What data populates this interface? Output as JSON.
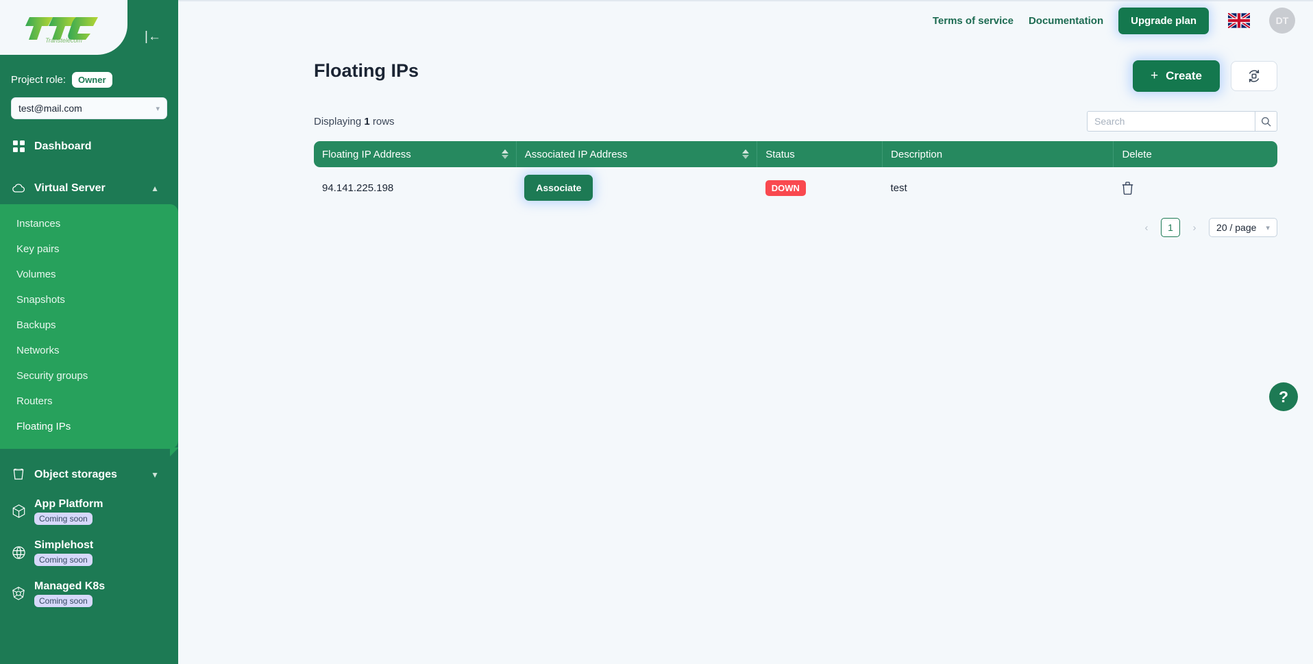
{
  "header": {
    "links": [
      {
        "label": "Terms of service",
        "name": "terms-of-service-link"
      },
      {
        "label": "Documentation",
        "name": "documentation-link"
      }
    ],
    "upgrade_label": "Upgrade plan",
    "language": "English",
    "avatar_initials": "DT"
  },
  "sidebar": {
    "logo_text": "TTC",
    "logo_subtext": "Transtelecom",
    "collapse_glyph": "|←",
    "role_label": "Project role:",
    "role_value": "Owner",
    "project": "test@mail.com",
    "dashboard": "Dashboard",
    "group": {
      "label": "Virtual Server",
      "items": [
        "Instances",
        "Key pairs",
        "Volumes",
        "Snapshots",
        "Backups",
        "Networks",
        "Security groups",
        "Routers",
        "Floating IPs"
      ],
      "active": "Floating IPs"
    },
    "object_storages": "Object storages",
    "soon_items": [
      {
        "label": "App Platform",
        "badge": "Coming soon"
      },
      {
        "label": "Simplehost",
        "badge": "Coming soon"
      },
      {
        "label": "Managed K8s",
        "badge": "Coming soon"
      }
    ]
  },
  "main": {
    "title": "Floating IPs",
    "create_label": "Create",
    "create_plus": "+",
    "rows_prefix": "Displaying ",
    "rows_count": "1",
    "rows_suffix": " rows",
    "search_placeholder": "Search",
    "search_value": "",
    "columns": [
      "Floating IP Address",
      "Associated IP Address",
      "Status",
      "Description",
      "Delete"
    ],
    "row": {
      "floating_ip": "94.141.225.198",
      "associate_label": "Associate",
      "status": "DOWN",
      "description": "test"
    },
    "pagination": {
      "prev": "‹",
      "page": "1",
      "next": "›",
      "page_size": "20 / page",
      "chevron": "∨"
    },
    "help_glyph": "?"
  },
  "colors": {
    "brand_green": "#1d7a54",
    "submenu_green": "#27a15c",
    "table_header_green": "#26895f",
    "status_red": "#f9494f",
    "page_bg": "#f4f8fb"
  }
}
